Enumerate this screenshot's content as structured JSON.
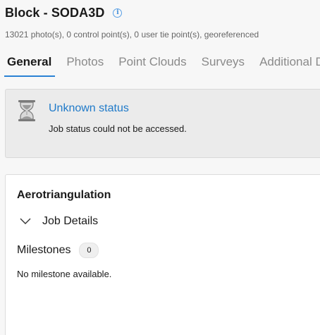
{
  "header": {
    "title": "Block - SODA3D",
    "info_icon": "info-circle-icon",
    "subtitle": "13021 photo(s), 0 control point(s), 0 user tie point(s), georeferenced"
  },
  "tabs": [
    {
      "label": "General",
      "active": true
    },
    {
      "label": "Photos",
      "active": false
    },
    {
      "label": "Point Clouds",
      "active": false
    },
    {
      "label": "Surveys",
      "active": false
    },
    {
      "label": "Additional Data",
      "active": false
    }
  ],
  "status": {
    "icon": "hourglass-icon",
    "title": "Unknown status",
    "message": "Job status could not be accessed."
  },
  "aerotriangulation": {
    "title": "Aerotriangulation",
    "job_details_label": "Job Details",
    "milestones_label": "Milestones",
    "milestones_count": "0",
    "empty_message": "No milestone available."
  },
  "colors": {
    "accent": "#2b82d4",
    "link": "#1f7ac9",
    "muted_text": "#8a8a8a",
    "status_bg": "#ebebeb"
  }
}
